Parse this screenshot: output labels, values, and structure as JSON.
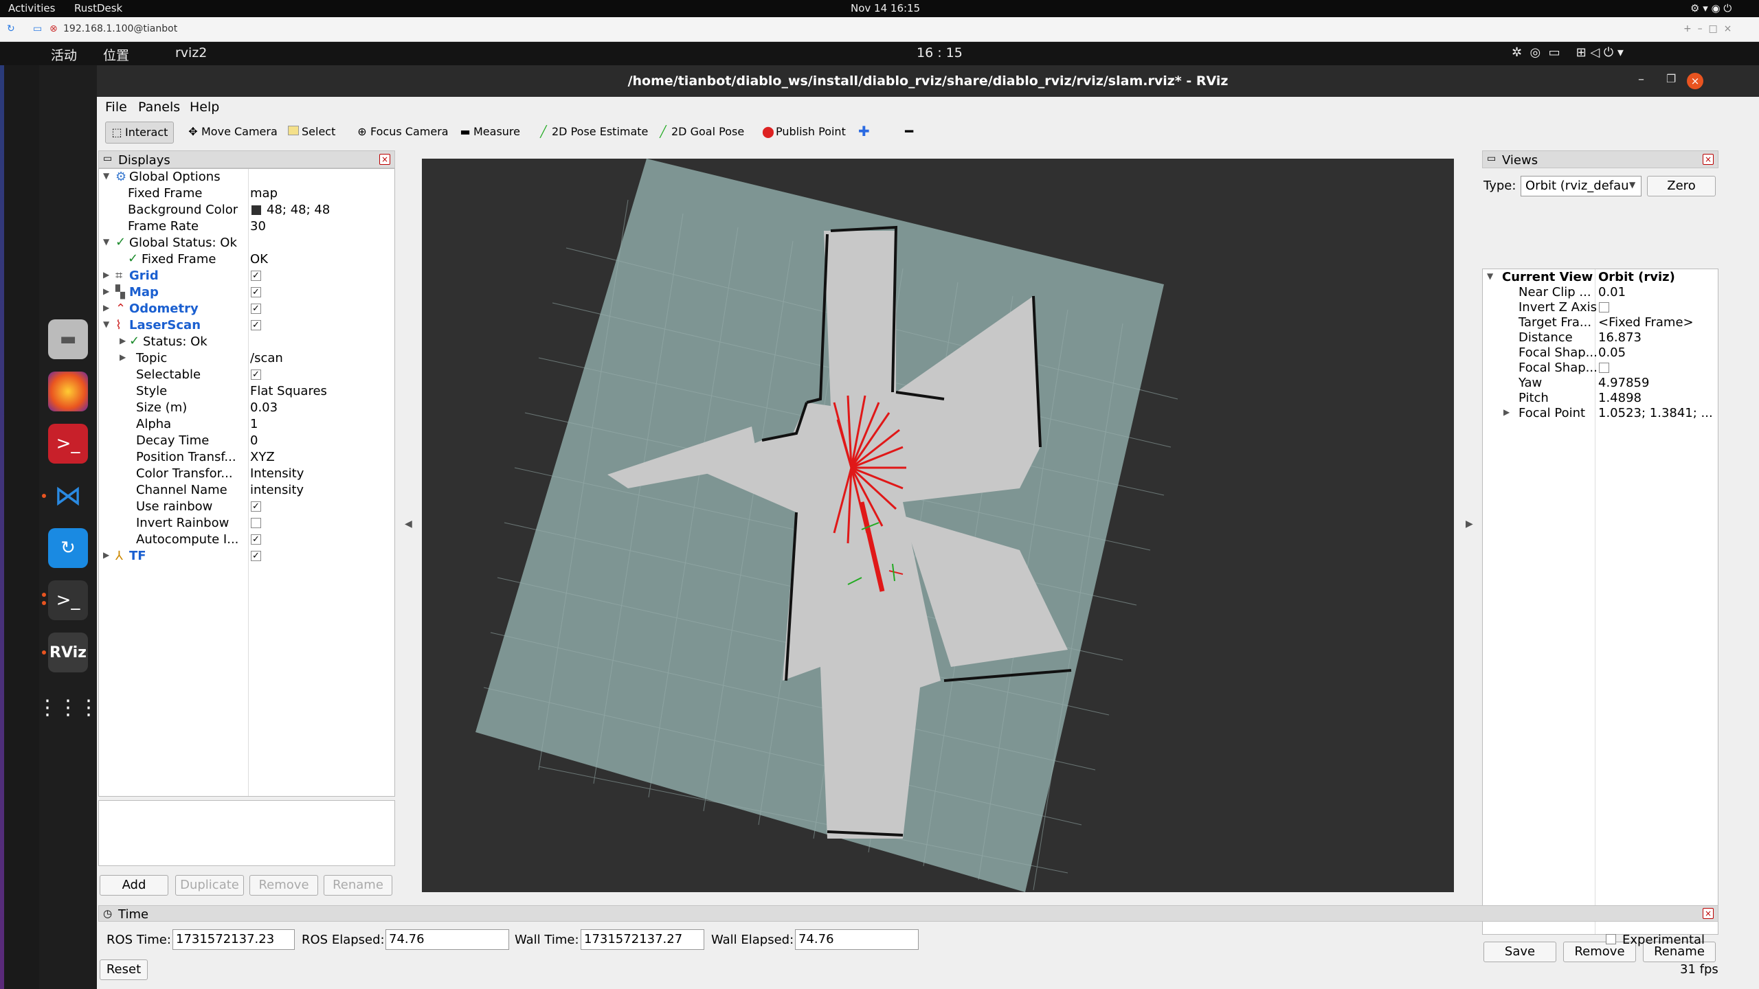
{
  "host": {
    "activities": "Activities",
    "app": "RustDesk",
    "clock": "Nov 14  16:15"
  },
  "rustdesk": {
    "tab_title": "192.168.1.100@tianbot"
  },
  "remote_bar": {
    "activities": "活动",
    "places": "位置",
    "app": "rviz2",
    "clock": "16 : 15"
  },
  "window": {
    "title": "/home/tianbot/diablo_ws/install/diablo_rviz/share/diablo_rviz/rviz/slam.rviz* - RViz"
  },
  "menu": [
    "File",
    "Panels",
    "Help"
  ],
  "toolbar": [
    {
      "label": "Interact",
      "icon": "cursor-icon"
    },
    {
      "label": "Move Camera",
      "icon": "move-icon"
    },
    {
      "label": "Select",
      "icon": "select-icon"
    },
    {
      "label": "Focus Camera",
      "icon": "focus-icon"
    },
    {
      "label": "Measure",
      "icon": "ruler-icon"
    },
    {
      "label": "2D Pose Estimate",
      "icon": "green-arrow-icon"
    },
    {
      "label": "2D Goal Pose",
      "icon": "green-arrow-icon"
    },
    {
      "label": "Publish Point",
      "icon": "pin-icon"
    }
  ],
  "displays": {
    "title": "Displays",
    "rows": [
      {
        "label": "Global Options",
        "value": ""
      },
      {
        "label": "Fixed Frame",
        "value": "map"
      },
      {
        "label": "Background Color",
        "value": "48; 48; 48"
      },
      {
        "label": "Frame Rate",
        "value": "30"
      },
      {
        "label": "Global Status: Ok",
        "value": ""
      },
      {
        "label": "Fixed Frame",
        "value": "OK"
      },
      {
        "label": "Grid",
        "value": ""
      },
      {
        "label": "Map",
        "value": ""
      },
      {
        "label": "Odometry",
        "value": ""
      },
      {
        "label": "LaserScan",
        "value": ""
      },
      {
        "label": "Status: Ok",
        "value": ""
      },
      {
        "label": "Topic",
        "value": "/scan"
      },
      {
        "label": "Selectable",
        "value": ""
      },
      {
        "label": "Style",
        "value": "Flat Squares"
      },
      {
        "label": "Size (m)",
        "value": "0.03"
      },
      {
        "label": "Alpha",
        "value": "1"
      },
      {
        "label": "Decay Time",
        "value": "0"
      },
      {
        "label": "Position Transf...",
        "value": "XYZ"
      },
      {
        "label": "Color Transfor...",
        "value": "Intensity"
      },
      {
        "label": "Channel Name",
        "value": "intensity"
      },
      {
        "label": "Use rainbow",
        "value": ""
      },
      {
        "label": "Invert Rainbow",
        "value": ""
      },
      {
        "label": "Autocompute I...",
        "value": ""
      },
      {
        "label": "TF",
        "value": ""
      }
    ],
    "buttons": [
      "Add",
      "Duplicate",
      "Remove",
      "Rename"
    ]
  },
  "views": {
    "title": "Views",
    "type_label": "Type:",
    "type_value": "Orbit (rviz_defau",
    "zero": "Zero",
    "rows": [
      {
        "label": "Current View",
        "value": "Orbit (rviz)"
      },
      {
        "label": "Near Clip ...",
        "value": "0.01"
      },
      {
        "label": "Invert Z Axis",
        "value": ""
      },
      {
        "label": "Target Fra...",
        "value": "<Fixed Frame>"
      },
      {
        "label": "Distance",
        "value": "16.873"
      },
      {
        "label": "Focal Shap...",
        "value": "0.05"
      },
      {
        "label": "Focal Shap...",
        "value": ""
      },
      {
        "label": "Yaw",
        "value": "4.97859"
      },
      {
        "label": "Pitch",
        "value": "1.4898"
      },
      {
        "label": "Focal Point",
        "value": "1.0523; 1.3841; ..."
      }
    ],
    "buttons": [
      "Save",
      "Remove",
      "Rename"
    ]
  },
  "time": {
    "title": "Time",
    "ros_time_label": "ROS Time:",
    "ros_time": "1731572137.23",
    "ros_elapsed_label": "ROS Elapsed:",
    "ros_elapsed": "74.76",
    "wall_time_label": "Wall Time:",
    "wall_time": "1731572137.27",
    "wall_elapsed_label": "Wall Elapsed:",
    "wall_elapsed": "74.76",
    "experimental": "Experimental",
    "reset": "Reset",
    "fps": "31 fps"
  }
}
